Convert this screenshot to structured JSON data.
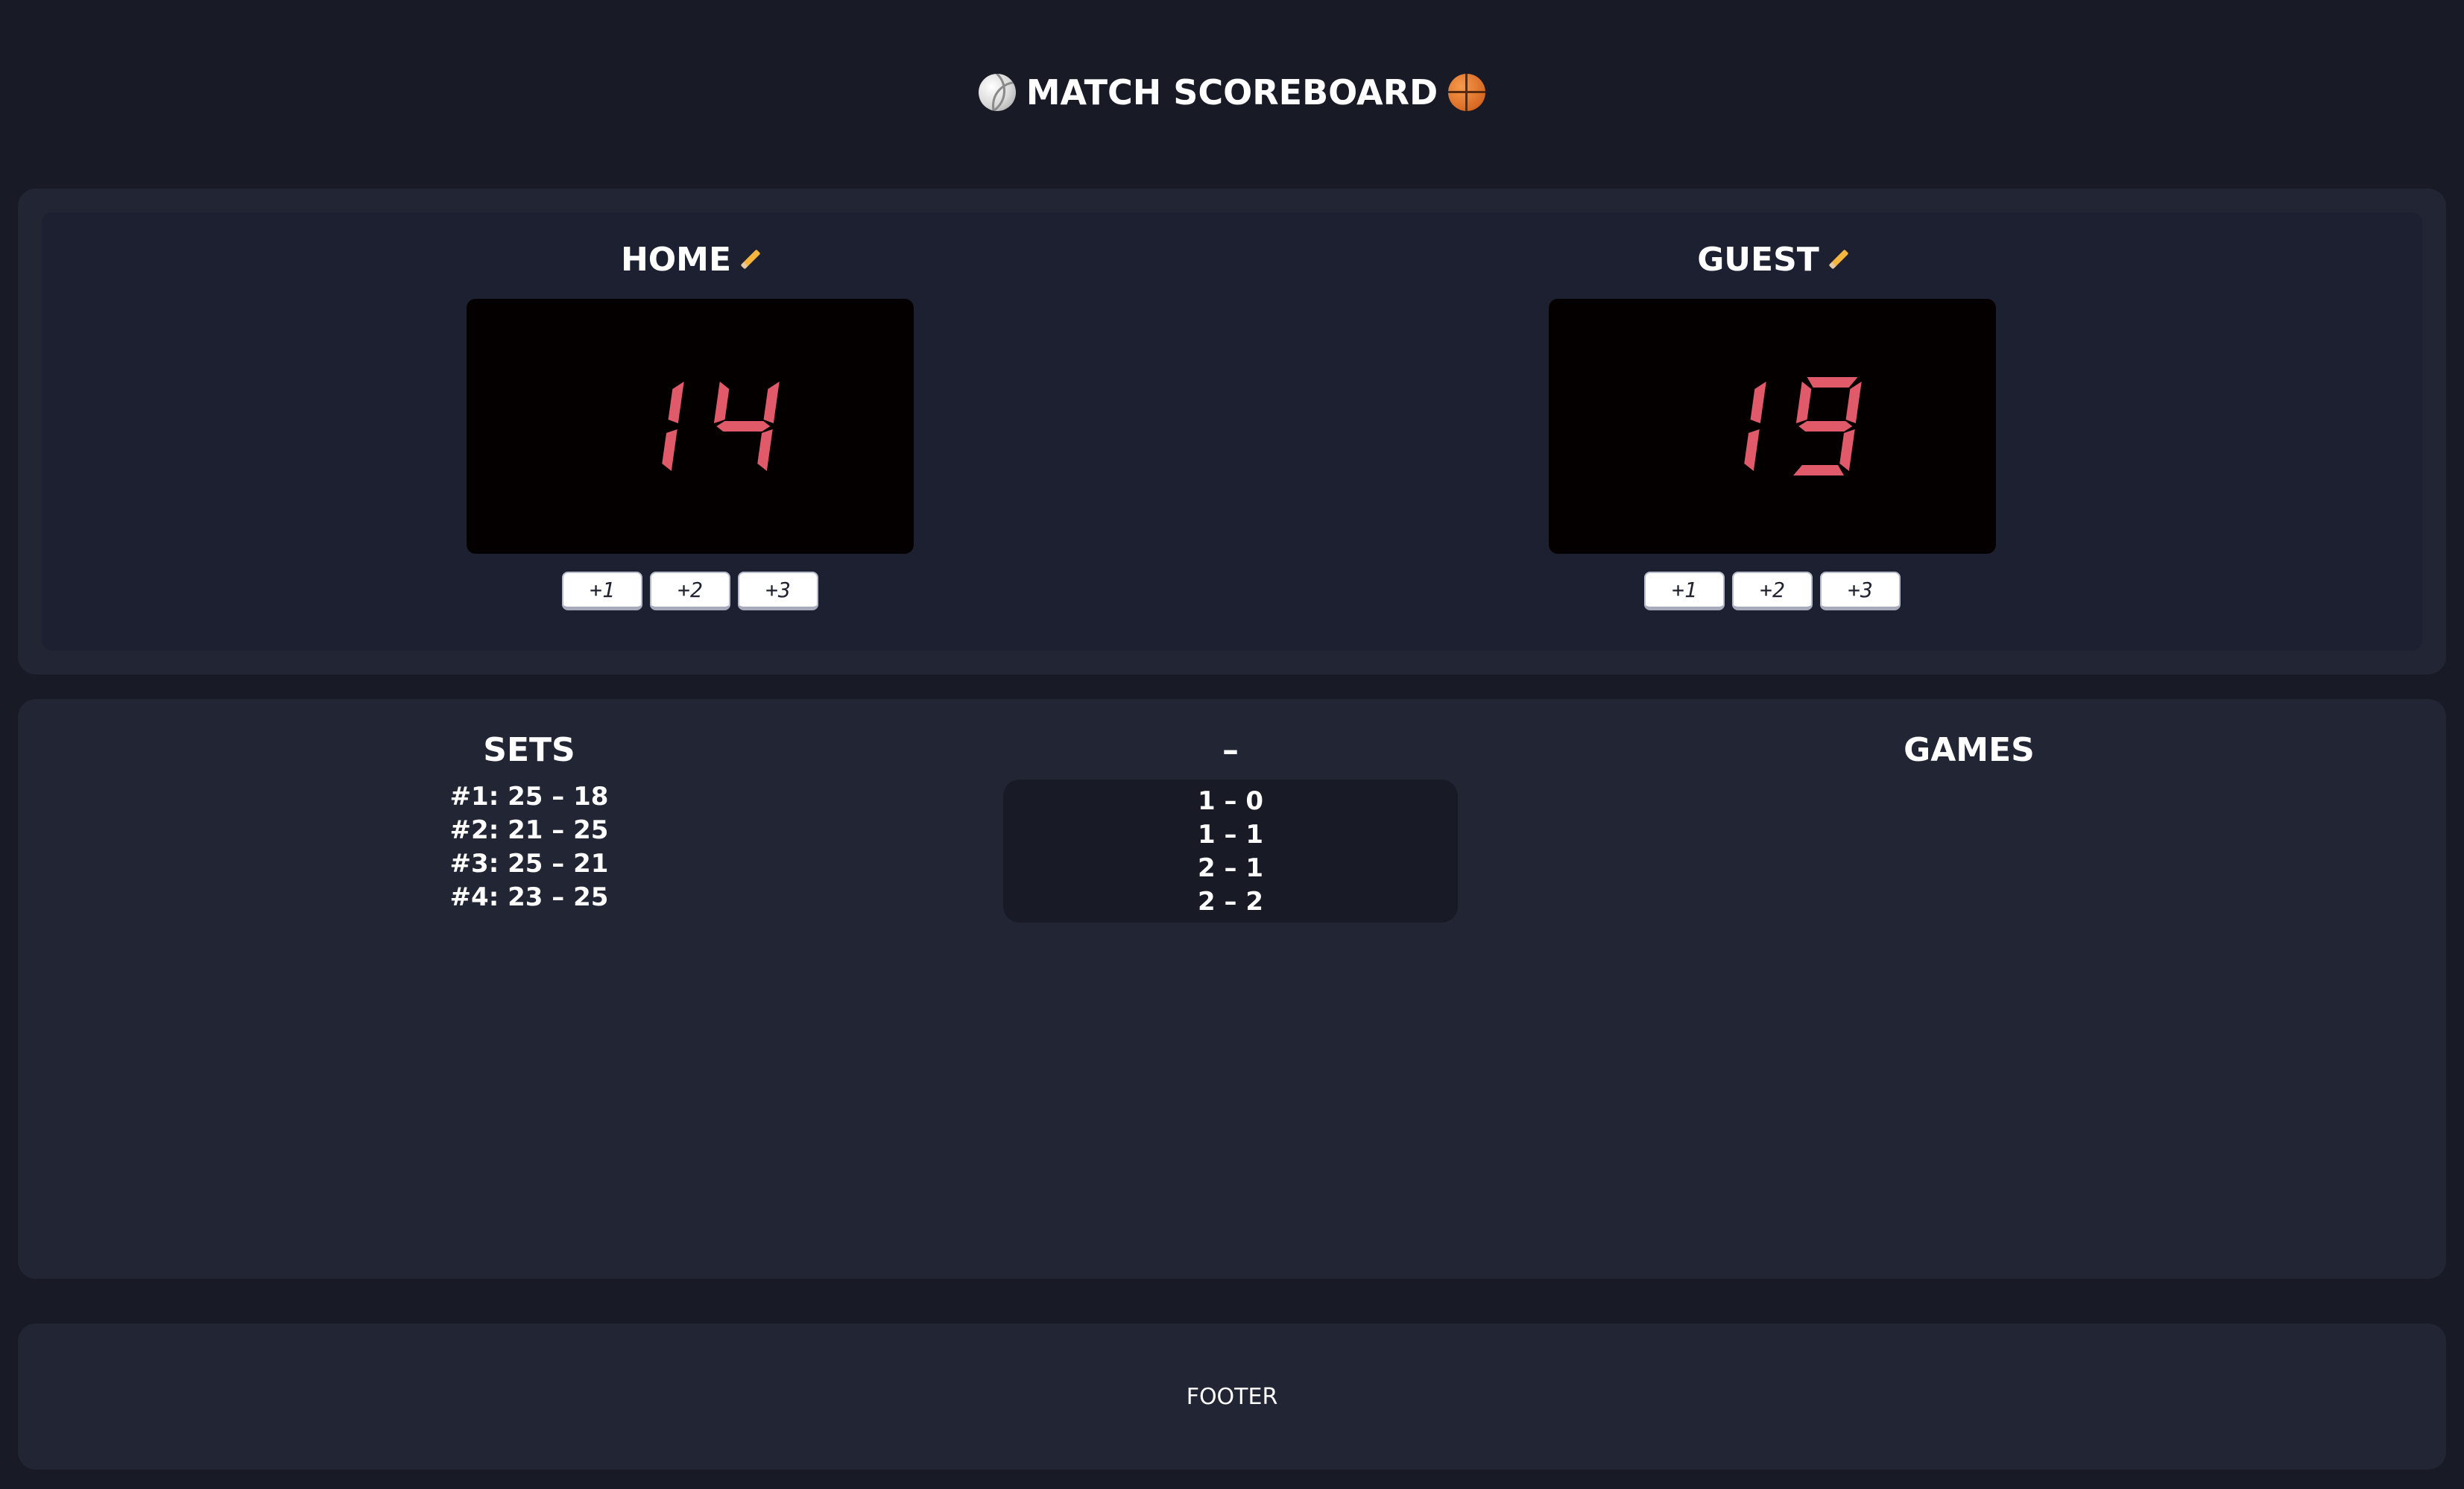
{
  "header": {
    "title": "MATCH SCOREBOARD",
    "left_icon": "volleyball-icon",
    "right_icon": "basketball-icon"
  },
  "home": {
    "name": "HOME",
    "score": 14,
    "buttons": [
      "+1",
      "+2",
      "+3"
    ]
  },
  "guest": {
    "name": "GUEST",
    "score": 19,
    "buttons": [
      "+1",
      "+2",
      "+3"
    ]
  },
  "stats": {
    "sets_header": "SETS",
    "middle_header": "–",
    "games_header": "GAMES",
    "sets": [
      "#1: 25 – 18",
      "#2: 21 – 25",
      "#3: 25 – 21",
      "#4: 23 – 25"
    ],
    "set_totals": [
      "1 – 0",
      "1 – 1",
      "2 – 1",
      "2 – 2"
    ],
    "games": []
  },
  "footer": {
    "text": "FOOTER"
  },
  "colors": {
    "background": "#181a26",
    "panel": "#222534",
    "score_digit": "#e05a6a",
    "score_bg": "#050000"
  }
}
